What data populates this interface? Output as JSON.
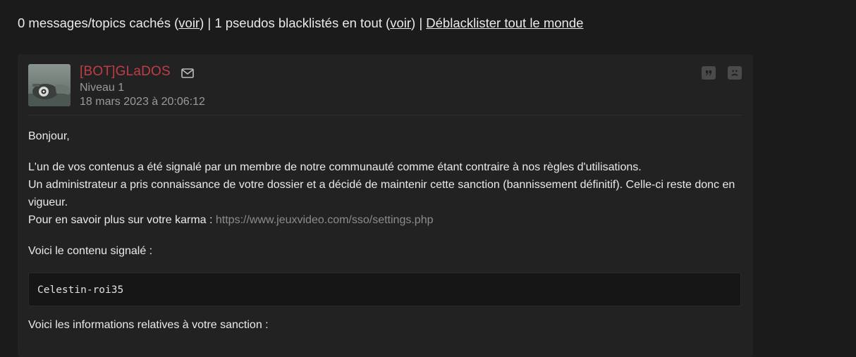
{
  "topbar": {
    "hidden_text": "0 messages/topics cachés (",
    "hidden_link": "voir",
    "sep1": ") | 1 pseudos blacklistés en tout (",
    "blacklist_link": "voir",
    "sep2": ") | ",
    "unblacklist_link": "Déblacklister tout le monde"
  },
  "post": {
    "author": "[BOT]GLaDOS",
    "level": "Niveau 1",
    "date": "18 mars 2023 à 20:06:12",
    "icons": {
      "mail": "mail-icon",
      "quote": "quote-icon",
      "report": "sad-face-icon"
    },
    "greeting": "Bonjour,",
    "line1": "L'un de vos contenus a été signalé par un membre de notre communauté comme étant contraire à nos règles d'utilisations.",
    "line2": "Un administrateur a pris connaissance de votre dossier et a décidé de maintenir cette sanction (bannissement définitif). Celle-ci reste donc en vigueur.",
    "line3_prefix": "Pour en savoir plus sur votre karma : ",
    "karma_link": "https://www.jeuxvideo.com/sso/settings.php",
    "content_label": "Voici le contenu signalé :",
    "reported_content": "Celestin-roi35",
    "sanction_label": "Voici les informations relatives à votre sanction :"
  },
  "colors": {
    "background": "#1b1b1b",
    "card": "#222222",
    "author": "#c03d48",
    "muted": "#9a9a9a",
    "link_muted": "#8c8c8c"
  }
}
